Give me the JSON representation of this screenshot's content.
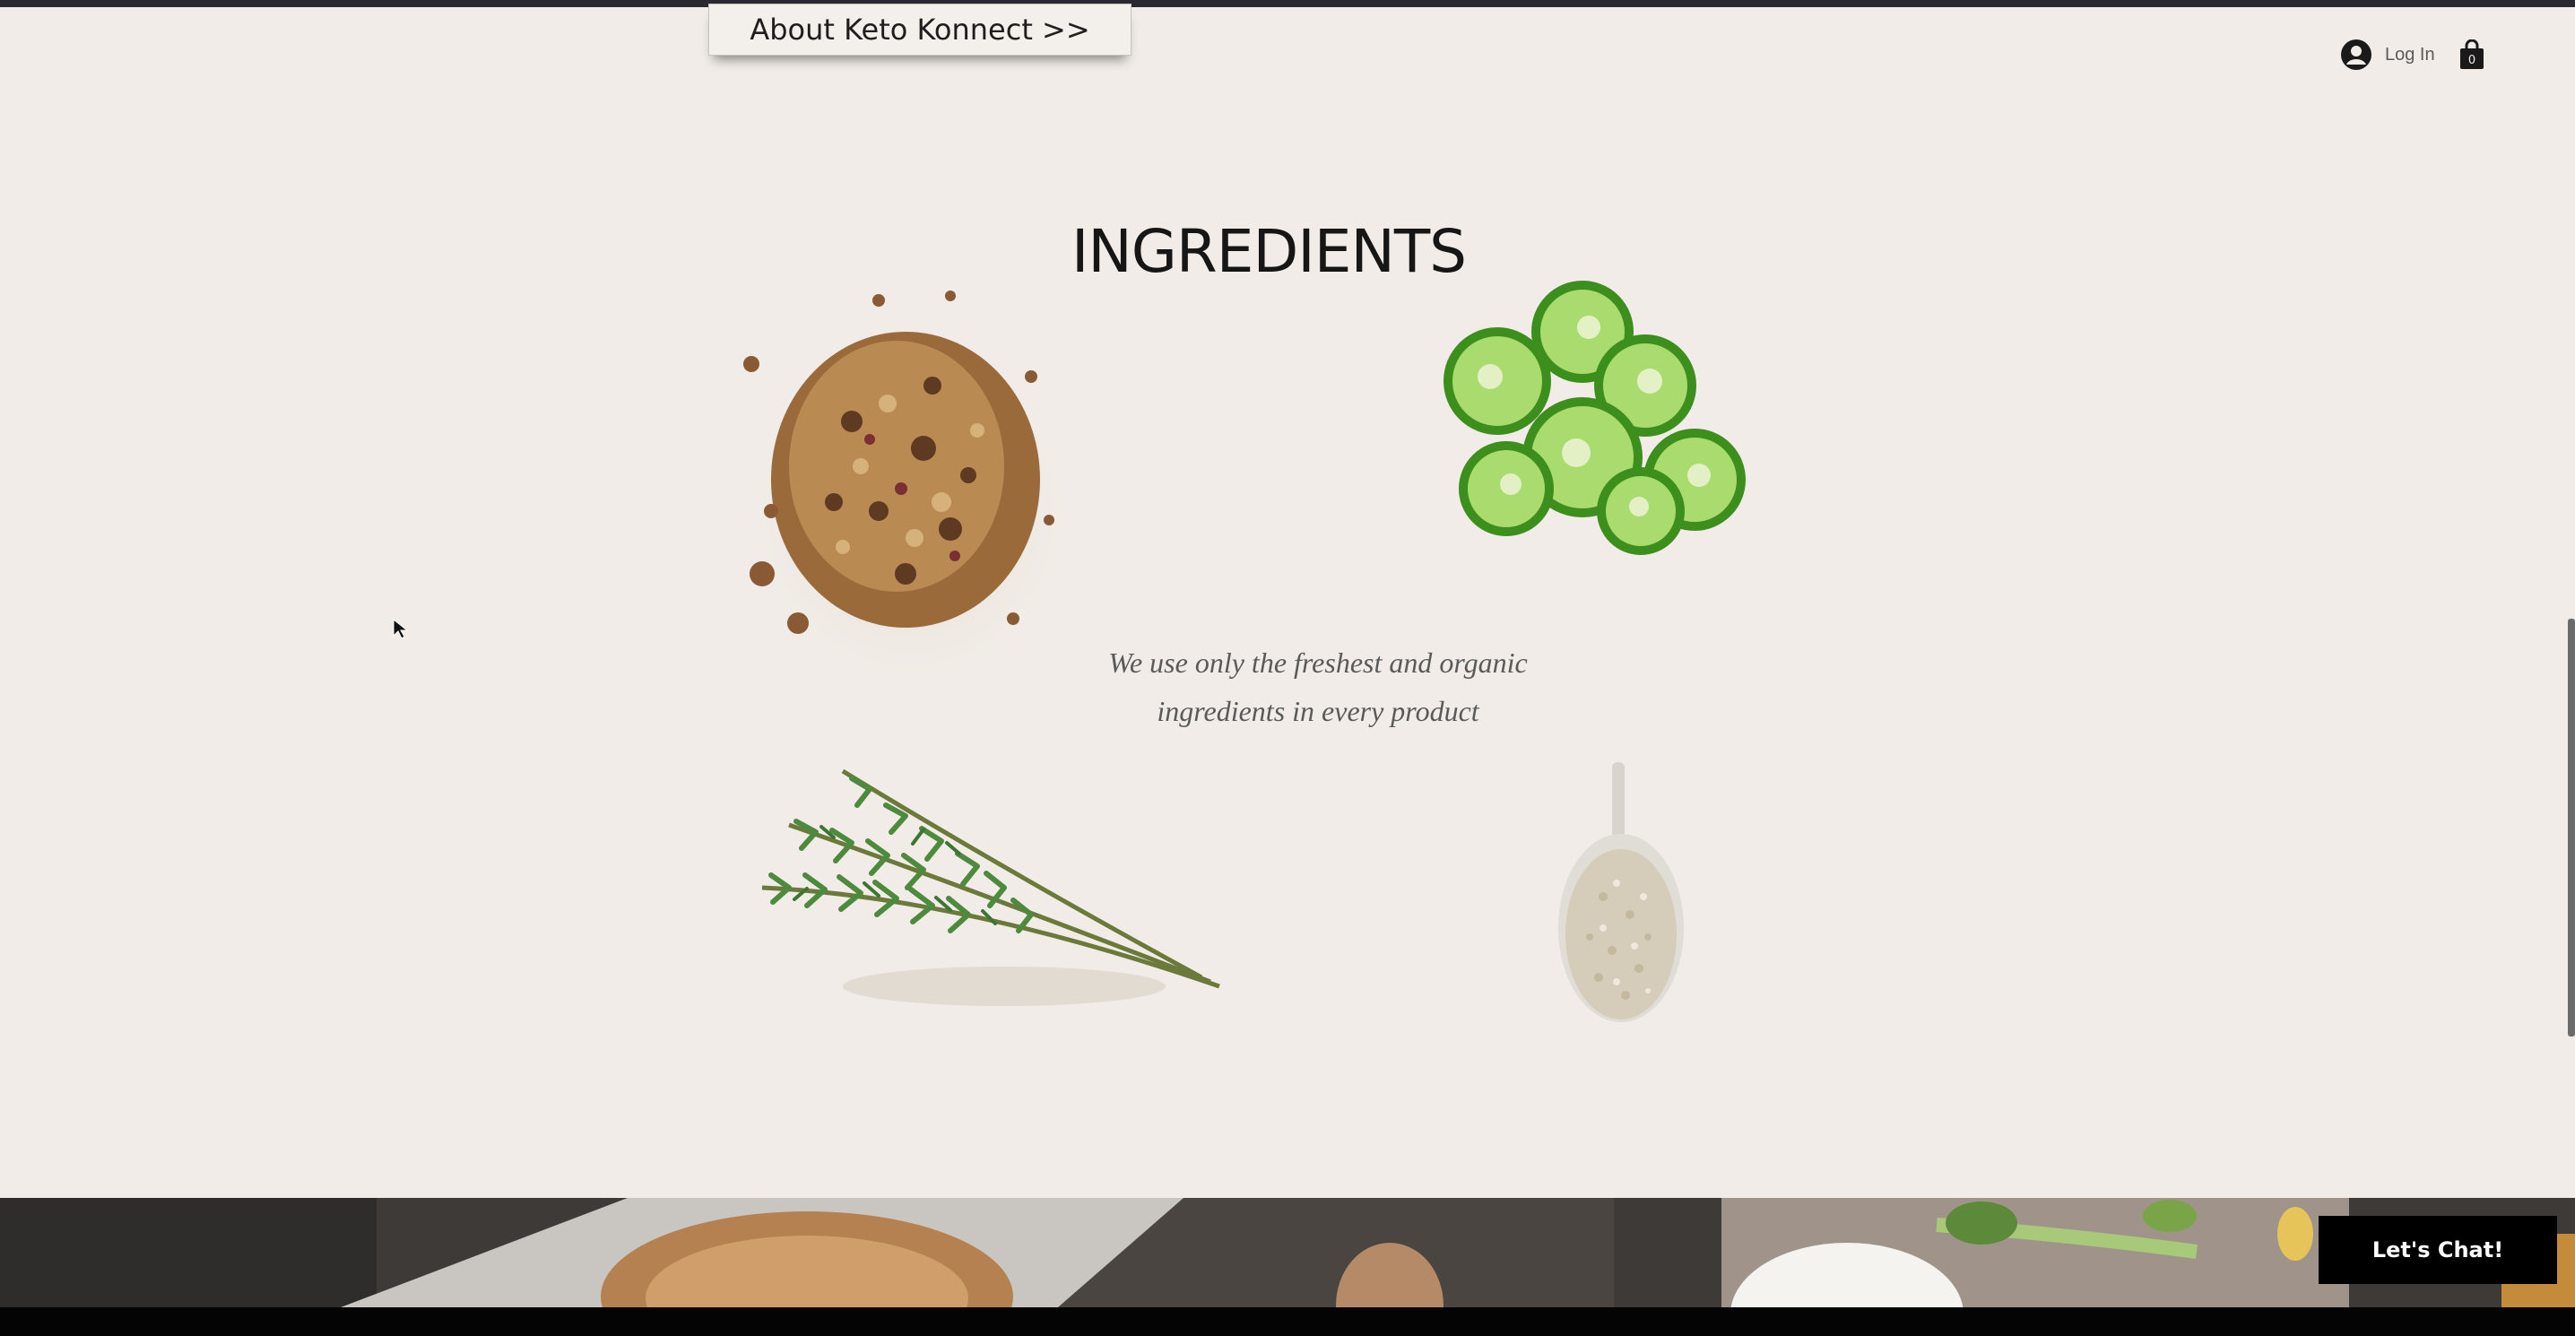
{
  "header": {
    "about_button": "About Keto Konnect >>",
    "login_label": "Log In",
    "login_icon": "user-avatar-icon",
    "cart_icon": "shopping-bag-icon",
    "cart_count": "0"
  },
  "ingredients_section": {
    "title": "INGREDIENTS",
    "tagline_line1": "We use only the freshest and organic",
    "tagline_line2": "ingredients in every product",
    "items": [
      {
        "name": "granola"
      },
      {
        "name": "jalapeno slices"
      },
      {
        "name": "rosemary"
      },
      {
        "name": "spoon of seeds"
      }
    ]
  },
  "chat": {
    "button_label": "Let's Chat!"
  },
  "colors": {
    "page_background": "#f1ece7",
    "chat_button": "#000000",
    "text": "#161616"
  }
}
